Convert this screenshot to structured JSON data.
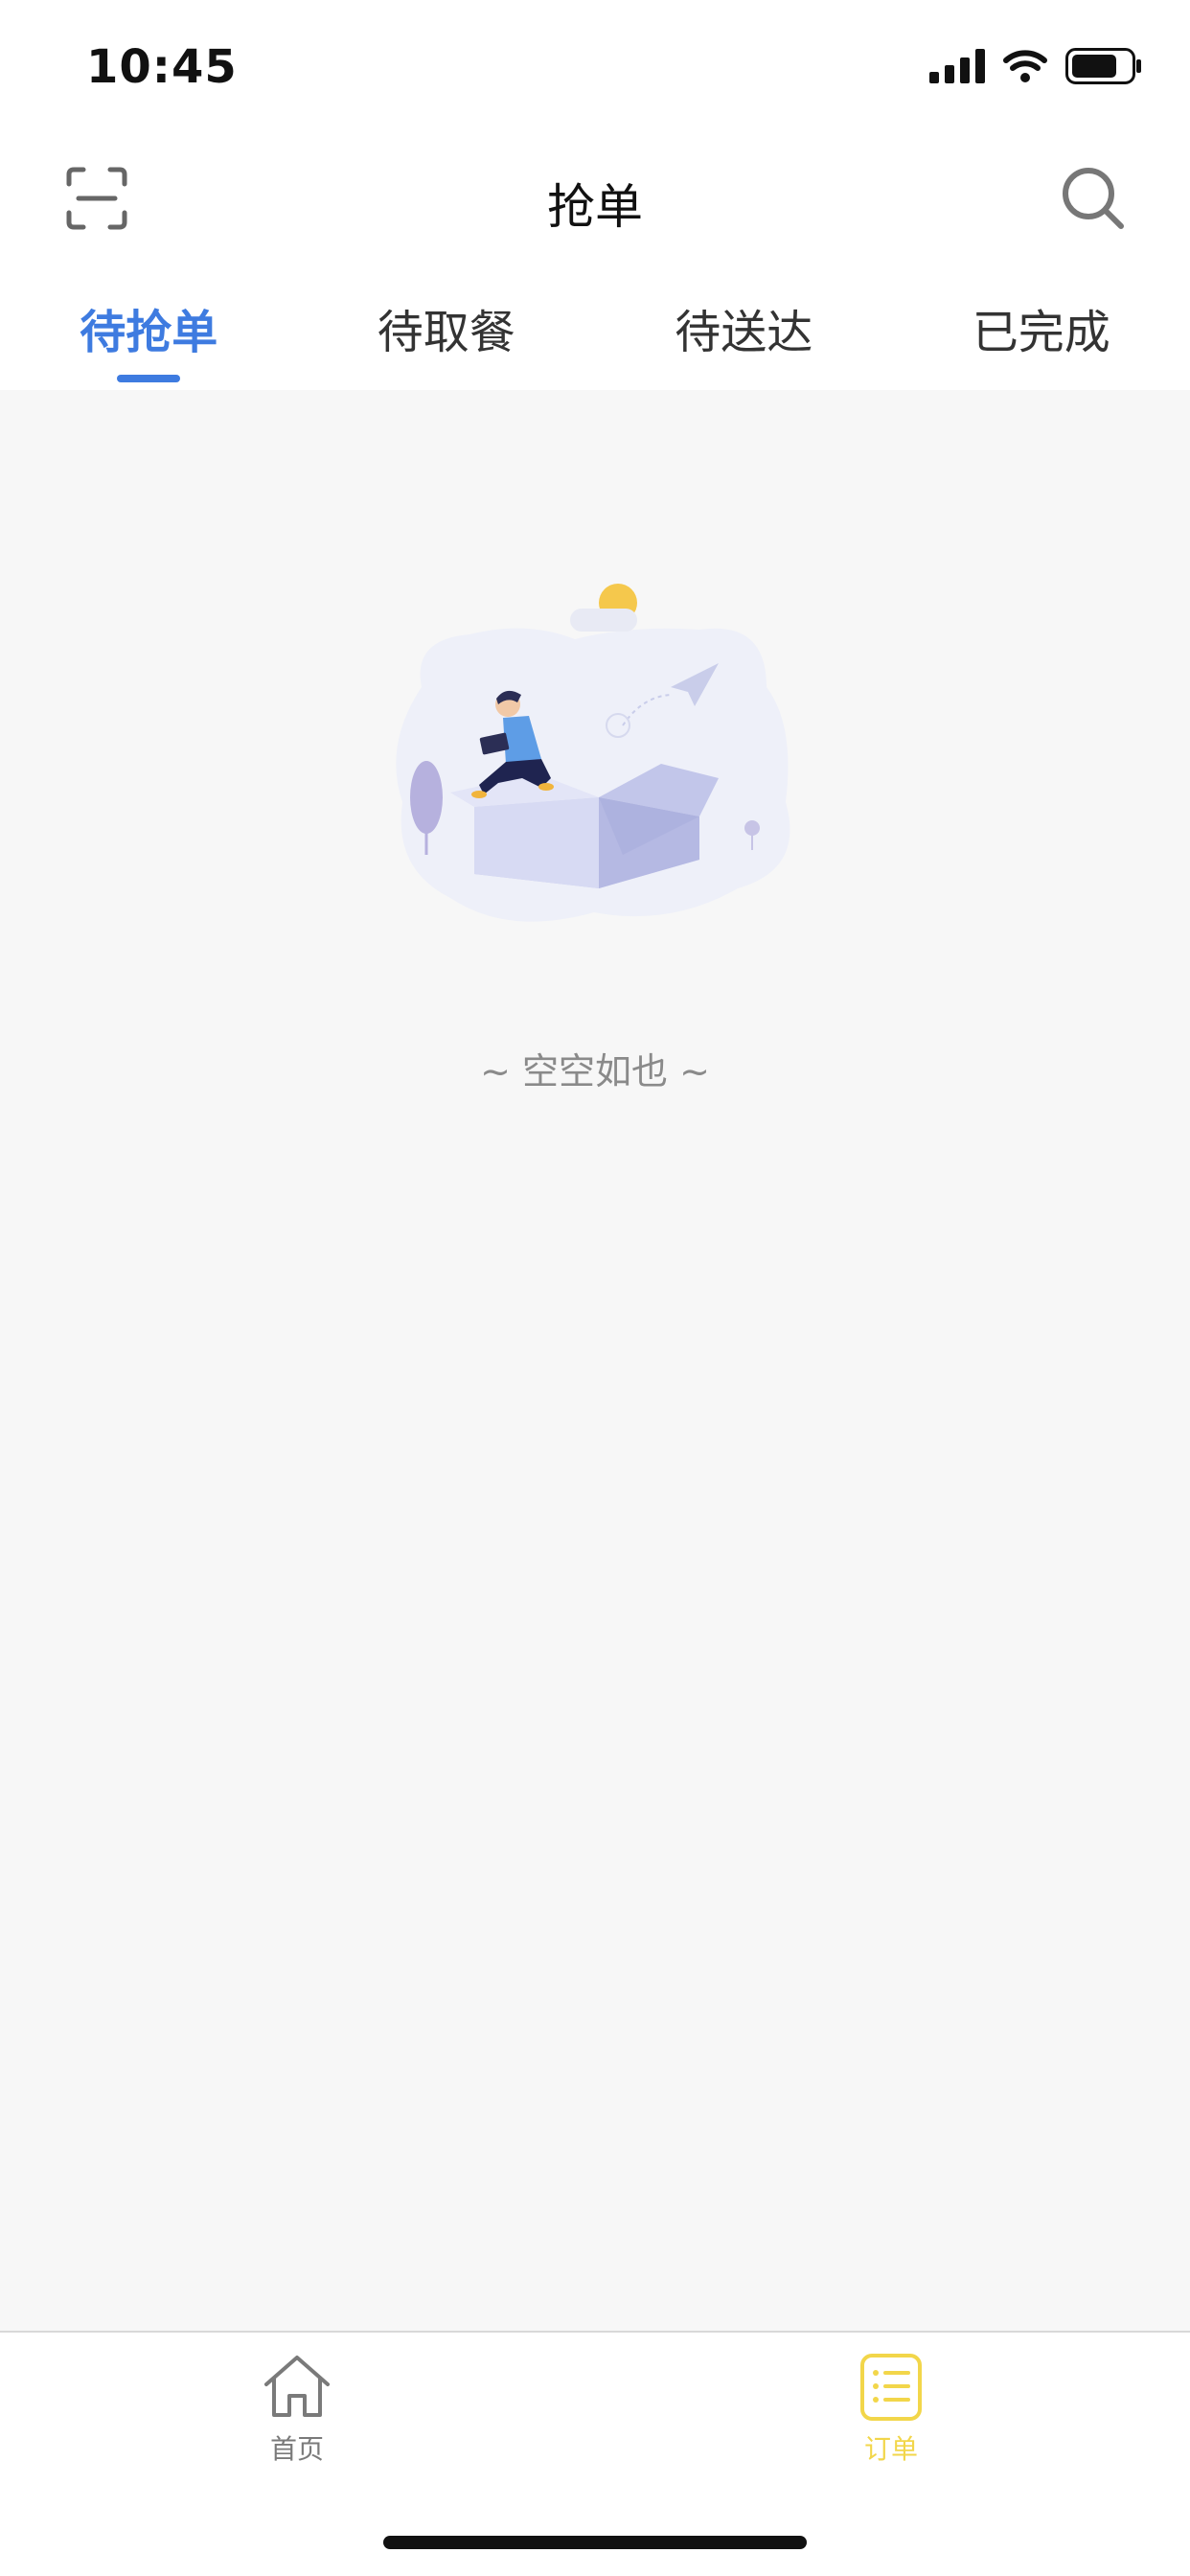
{
  "status_bar": {
    "time": "10:45"
  },
  "nav": {
    "title": "抢单"
  },
  "tabs": [
    {
      "label": "待抢单",
      "active": true
    },
    {
      "label": "待取餐",
      "active": false
    },
    {
      "label": "待送达",
      "active": false
    },
    {
      "label": "已完成",
      "active": false
    }
  ],
  "empty_state": {
    "text": "~ 空空如也 ~"
  },
  "bottom_tabs": [
    {
      "label": "首页",
      "icon": "home-icon",
      "active": false
    },
    {
      "label": "订单",
      "icon": "order-list-icon",
      "active": true
    }
  ],
  "colors": {
    "accent": "#3E7BE0",
    "bottom_active": "#F2D64A",
    "bottom_inactive": "#7A7A7A",
    "content_bg": "#F7F7F7"
  }
}
